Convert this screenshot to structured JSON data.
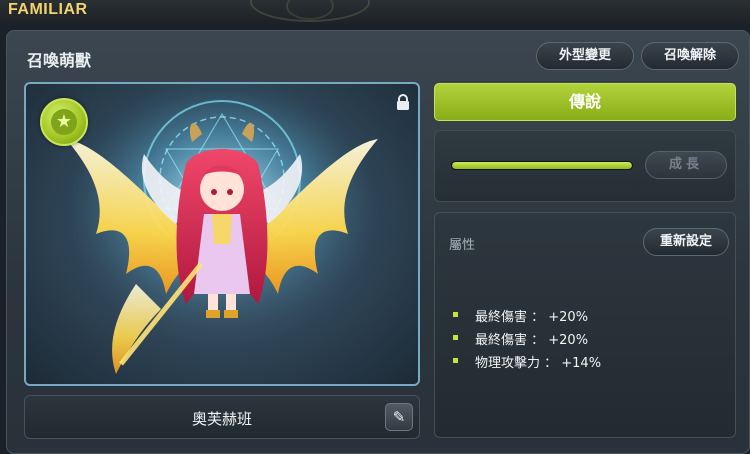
{
  "window": {
    "title": "FAMILIAR"
  },
  "header": {
    "title": "召喚萌獸",
    "change_look_label": "外型變更",
    "release_label": "召喚解除"
  },
  "familiar": {
    "name": "奧芙赫班",
    "grade": "傳說",
    "growth_progress": 1.0,
    "growth_label": "成長"
  },
  "attributes": {
    "label": "屬性",
    "reset_label": "重新設定",
    "items": [
      {
        "text": "最終傷害 ： +20%"
      },
      {
        "text": "最終傷害 ： +20%"
      },
      {
        "text": "物理攻擊力 ： +14%"
      }
    ]
  },
  "colors": {
    "accent_green": "#9ec421",
    "title_gold": "#f3d36b",
    "portrait_border": "#78a9c2"
  },
  "icons": {
    "grade_badge": "star-icon",
    "lock": "lock-icon",
    "edit": "pencil-icon"
  }
}
